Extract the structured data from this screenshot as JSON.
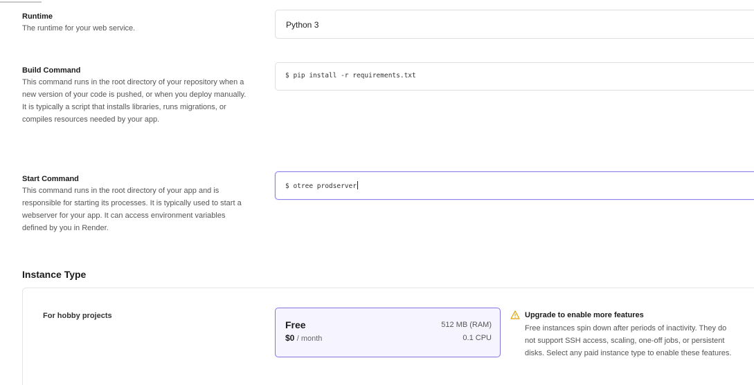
{
  "runtime": {
    "label": "Runtime",
    "description": "The runtime for your web service.",
    "selected": "Python 3"
  },
  "build": {
    "label": "Build Command",
    "description": "This command runs in the root directory of your repository when a new version of your code is pushed, or when you deploy manually. It is typically a script that installs libraries, runs migrations, or compiles resources needed by your app.",
    "value": "$ pip install -r requirements.txt"
  },
  "start": {
    "label": "Start Command",
    "description": "This command runs in the root directory of your app and is responsible for starting its processes. It is typically used to start a webserver for your app. It can access environment variables defined by you in Render.",
    "value": "$ otree prodserver"
  },
  "instance": {
    "title": "Instance Type",
    "group_label": "For hobby projects",
    "plan": {
      "name": "Free",
      "price": "$0",
      "period": "/ month",
      "ram": "512 MB (RAM)",
      "cpu": "0.1 CPU"
    },
    "notice": {
      "icon": "warning-icon",
      "title": "Upgrade to enable more features",
      "text": "Free instances spin down after periods of inactivity. They do not support SSH access, scaling, one-off jobs, or persistent disks. Select any paid instance type to enable these features."
    }
  },
  "colors": {
    "accent": "#7f74e0",
    "selected_bg": "#f6f5ff",
    "warning": "#e0a100",
    "border": "#dedede"
  }
}
